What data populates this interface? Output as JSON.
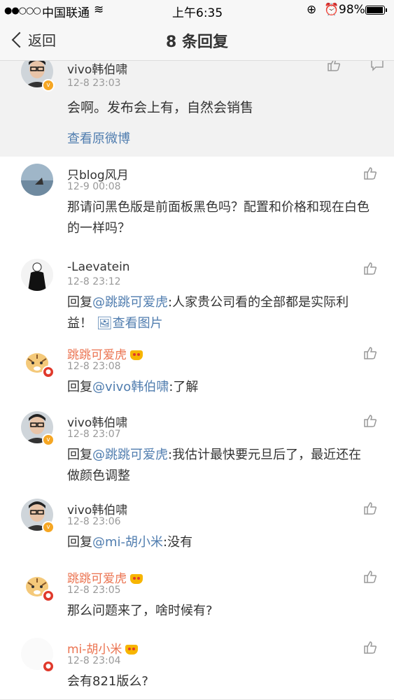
{
  "status": {
    "signal": "●●○○○",
    "carrier": "中国联通",
    "wifi": "≋",
    "time": "上午6:35",
    "lock": "⊕",
    "alarm": "⏰",
    "battery": "98%",
    "battery_level": 0.98
  },
  "nav": {
    "back": "返回",
    "title": "8 条回复"
  },
  "main": {
    "name": "vivo韩伯啸",
    "time": "12-8 23:03",
    "text": "会啊。发布会上有，自然会销售",
    "link": "查看原微博"
  },
  "comments": [
    {
      "name": "只blog风月",
      "time": "12-9 00:08",
      "text": "那请问黑色版是前面板黑色吗？配置和价格和现在白色的一样吗？"
    },
    {
      "name": "-Laevatein",
      "time": "12-8 23:12",
      "prefix": "回复",
      "mention": "@跳跳可爱虎",
      "text": ":人家贵公司看的全部都是实际利益！",
      "img": "查看图片"
    },
    {
      "name": "跳跳可爱虎",
      "time": "12-8 23:08",
      "prefix": "回复",
      "mention": "@vivo韩伯啸",
      "text": ":了解"
    },
    {
      "name": "vivo韩伯啸",
      "time": "12-8 23:07",
      "prefix": "回复",
      "mention": "@跳跳可爱虎",
      "text": ":我估计最快要元旦后了，最近还在做颜色调整"
    },
    {
      "name": "vivo韩伯啸",
      "time": "12-8 23:06",
      "prefix": "回复",
      "mention": "@mi-胡小米",
      "text": ":没有"
    },
    {
      "name": "跳跳可爱虎",
      "time": "12-8 23:05",
      "text": "那么问题来了，啥时候有?"
    },
    {
      "name": "mi-胡小米",
      "time": "12-8 23:04",
      "text": "会有821版么?"
    }
  ],
  "colors": {
    "link": "#507daf",
    "orange_name": "#eb7350",
    "time": "#999999"
  }
}
